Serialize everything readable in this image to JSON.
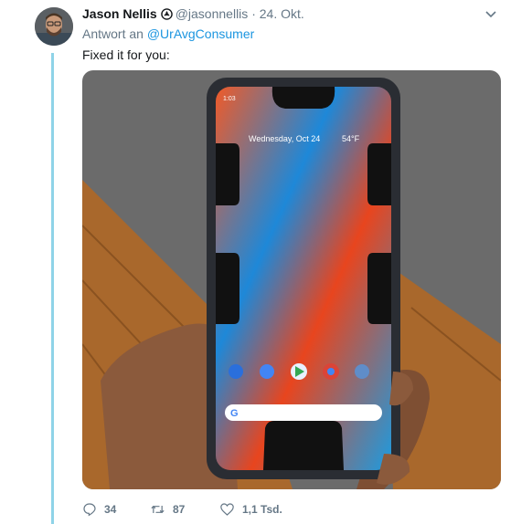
{
  "tweet": {
    "author_name": "Jason Nellis",
    "author_handle": "@jasonnellis",
    "separator": "·",
    "date": "24. Okt.",
    "reply_prefix": "Antwort an",
    "reply_to": "@UrAvgConsumer",
    "text": "Fixed it for you:",
    "media": {
      "status_time": "1:03",
      "weather": "54°F",
      "lockscreen_date": "Wednesday, Oct 24",
      "description_alt": "Photo of a hand holding a Pixel 3 XL smartphone"
    },
    "actions": {
      "replies": "34",
      "retweets": "87",
      "likes": "1,1 Tsd."
    }
  },
  "colors": {
    "link": "#1b95e0",
    "muted": "#657786",
    "thread_line": "#8fd3e8"
  },
  "icons": [
    "verified-icon",
    "chevron-down-icon",
    "reply-icon",
    "retweet-icon",
    "like-icon"
  ]
}
